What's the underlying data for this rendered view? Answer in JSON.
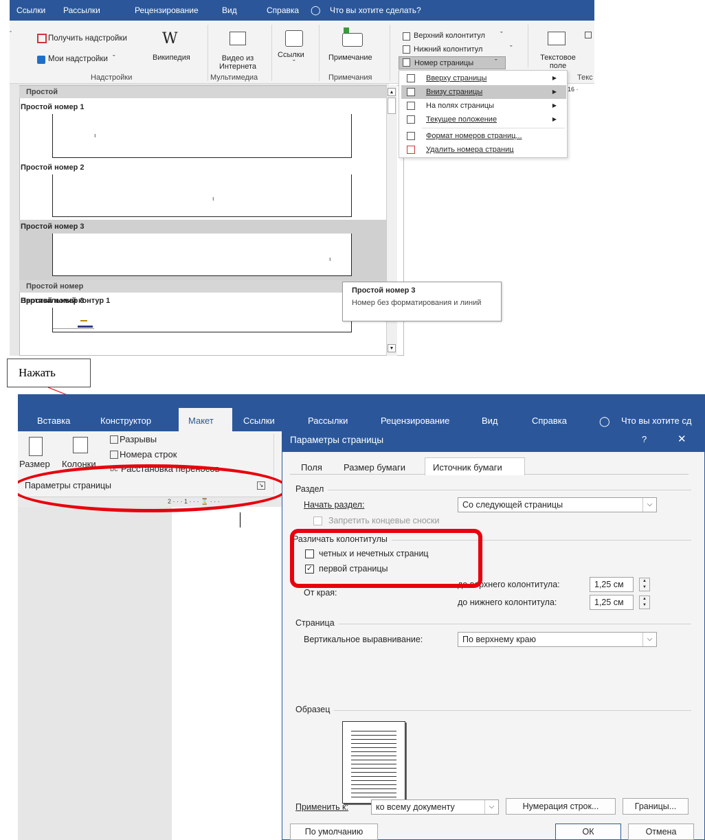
{
  "top": {
    "tabs": [
      "Ссылки",
      "Рассылки",
      "Рецензирование",
      "Вид",
      "Справка"
    ],
    "search": "Что вы хотите сделать?",
    "addins": {
      "get": "Получить надстройки",
      "my": "Мои надстройки",
      "wiki": "Википедия",
      "group": "Надстройки"
    },
    "media": {
      "video": "Видео из Интернета",
      "group": "Мультимедиа"
    },
    "links": {
      "label": "Ссылки"
    },
    "comments": {
      "note": "Примечание",
      "group": "Примечания"
    },
    "header_footer": {
      "header": "Верхний колонтитул",
      "footer": "Нижний колонтитул",
      "page_number": "Номер страницы"
    },
    "text": {
      "textbox": "Текстовое поле",
      "group_partial": "Текс"
    },
    "ruler_partial": "16 ·"
  },
  "gallery": {
    "section1": "Простой",
    "items": [
      "Простой номер 1",
      "Простой номер 2",
      "Простой номер 3"
    ],
    "page_num_glyph": "ı",
    "section2": "Простой номер",
    "item4": "Вертикальный контур 1"
  },
  "menu": {
    "items": [
      {
        "label": "Вверху страницы",
        "arrow": "▶"
      },
      {
        "label": "Внизу страницы",
        "arrow": "▶"
      },
      {
        "label": "На полях страницы",
        "arrow": "▶"
      },
      {
        "label": "Текущее положение",
        "arrow": "▶"
      },
      {
        "label": "Формат номеров страниц...",
        "arrow": ""
      },
      {
        "label": "Удалить номера страниц",
        "arrow": ""
      }
    ]
  },
  "tooltip": {
    "title": "Простой номер 3",
    "body": "Номер без форматирования и линий"
  },
  "callout": "Нажать",
  "bottom": {
    "tabs": [
      "Вставка",
      "Конструктор",
      "Макет",
      "Ссылки",
      "Рассылки",
      "Рецензирование",
      "Вид",
      "Справка"
    ],
    "search": "Что вы хотите сд",
    "layout": {
      "size": "Размер",
      "columns": "Колонки",
      "breaks": "Разрывы",
      "line_numbers": "Номера строк",
      "hyphenation": "Расстановка переносов",
      "group": "Параметры страницы"
    },
    "ruler": "2 · · · 1 · · · ⌛ · · ·"
  },
  "dialog": {
    "title": "Параметры страницы",
    "help": "?",
    "close": "✕",
    "tabs": [
      "Поля",
      "Размер бумаги",
      "Источник бумаги"
    ],
    "section": {
      "title": "Раздел",
      "start_label": "Начать раздел:",
      "start_value": "Со следующей страницы",
      "suppress_endnotes": "Запретить концевые сноски"
    },
    "headers": {
      "title": "Различать колонтитулы",
      "odd_even": "четных и нечетных страниц",
      "odd_even_checked": false,
      "first_page": "первой страницы",
      "first_page_checked": true,
      "from_edge": "От края:",
      "header_label": "до верхнего колонтитула:",
      "header_value": "1,25 см",
      "footer_label": "до нижнего колонтитула:",
      "footer_value": "1,25 см"
    },
    "page": {
      "title": "Страница",
      "valign_label": "Вертикальное выравнивание:",
      "valign_value": "По верхнему краю"
    },
    "preview": {
      "title": "Образец"
    },
    "apply_label": "Применить к:",
    "apply_value": "ко всему документу",
    "line_numbers_btn": "Нумерация строк...",
    "borders_btn": "Границы...",
    "default_btn": "По умолчанию",
    "ok": "ОК",
    "cancel": "Отмена"
  },
  "colors": {
    "ribbon_blue": "#2b579a",
    "highlight_red": "#e8000c"
  }
}
